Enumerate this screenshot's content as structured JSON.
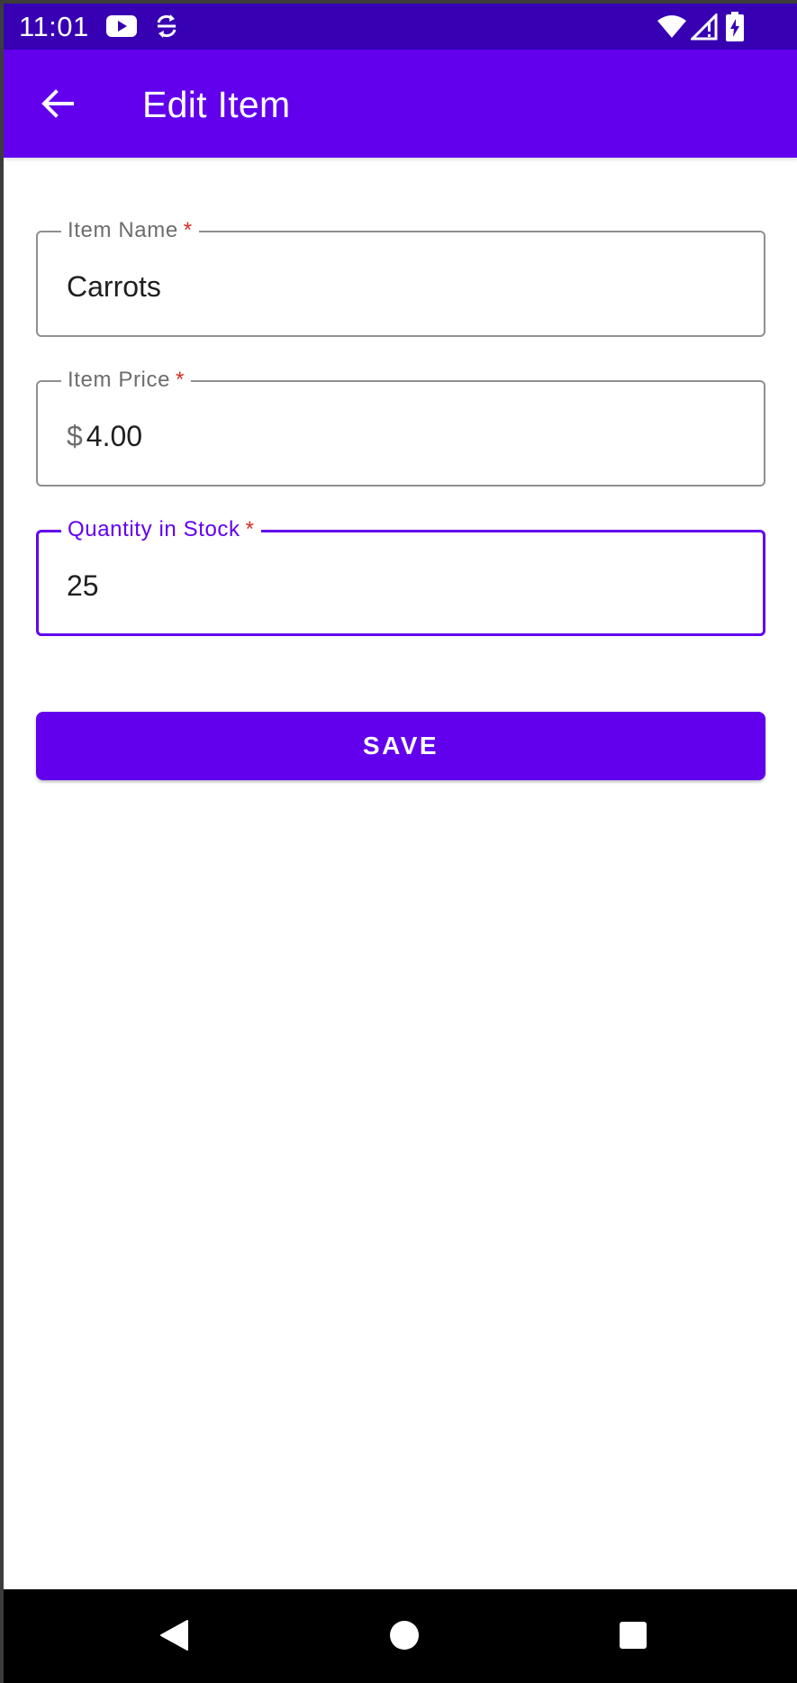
{
  "status_bar": {
    "time": "11:01",
    "icons": [
      "youtube-icon",
      "sync-icon",
      "wifi-icon",
      "signal-icon",
      "battery-icon"
    ],
    "background": "#3700b3"
  },
  "app_bar": {
    "title": "Edit Item",
    "back_icon": "arrow-back-icon",
    "background": "#6200ee"
  },
  "form": {
    "item_name": {
      "label": "Item Name",
      "required_marker": "*",
      "value": "Carrots"
    },
    "item_price": {
      "label": "Item Price",
      "required_marker": "*",
      "prefix": "$",
      "value": "4.00"
    },
    "quantity": {
      "label": "Quantity in Stock",
      "required_marker": "*",
      "value": "25",
      "focused": true
    },
    "save_label": "SAVE"
  },
  "nav_bar": {
    "buttons": [
      "nav-back-icon",
      "nav-home-icon",
      "nav-recents-icon"
    ]
  },
  "colors": {
    "primary": "#6200ee",
    "primary_dark": "#3700b3",
    "required": "#d62d20"
  }
}
